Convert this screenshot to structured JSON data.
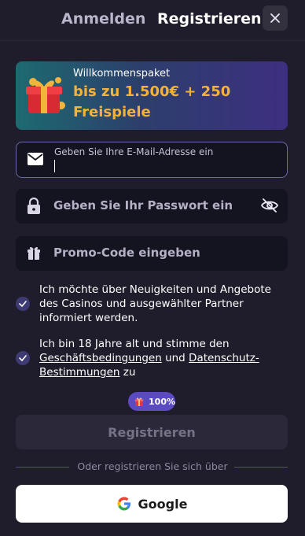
{
  "tabs": {
    "login": "Anmelden",
    "register": "Registrieren"
  },
  "banner": {
    "title": "Willkommenspaket",
    "offer_line1": "bis zu 1.500€ + 250",
    "offer_line2": "Freispiele"
  },
  "email": {
    "label": "Geben Sie Ihre E-Mail-Adresse ein",
    "value": ""
  },
  "password": {
    "placeholder": "Geben Sie Ihr Passwort ein"
  },
  "promo": {
    "placeholder": "Promo-Code eingeben"
  },
  "consents": {
    "newsletter": "Ich möchte über Neuigkeiten und Angebote des Casinos und ausgewählter Partner informiert werden.",
    "age_prefix": "Ich bin 18 Jahre alt und stimme den",
    "terms_link": "Geschäftsbedingungen",
    "and": "und",
    "privacy_link": "Datenschutz-Bestimmungen",
    "age_suffix": "zu"
  },
  "bonus_badge": "100%",
  "register_button": "Registrieren",
  "divider": "Oder registrieren Sie sich über",
  "google_button": "Google",
  "colors": {
    "background": "#1f1d2b",
    "accent": "#5b4bc2",
    "offer": "#f6b13b"
  }
}
